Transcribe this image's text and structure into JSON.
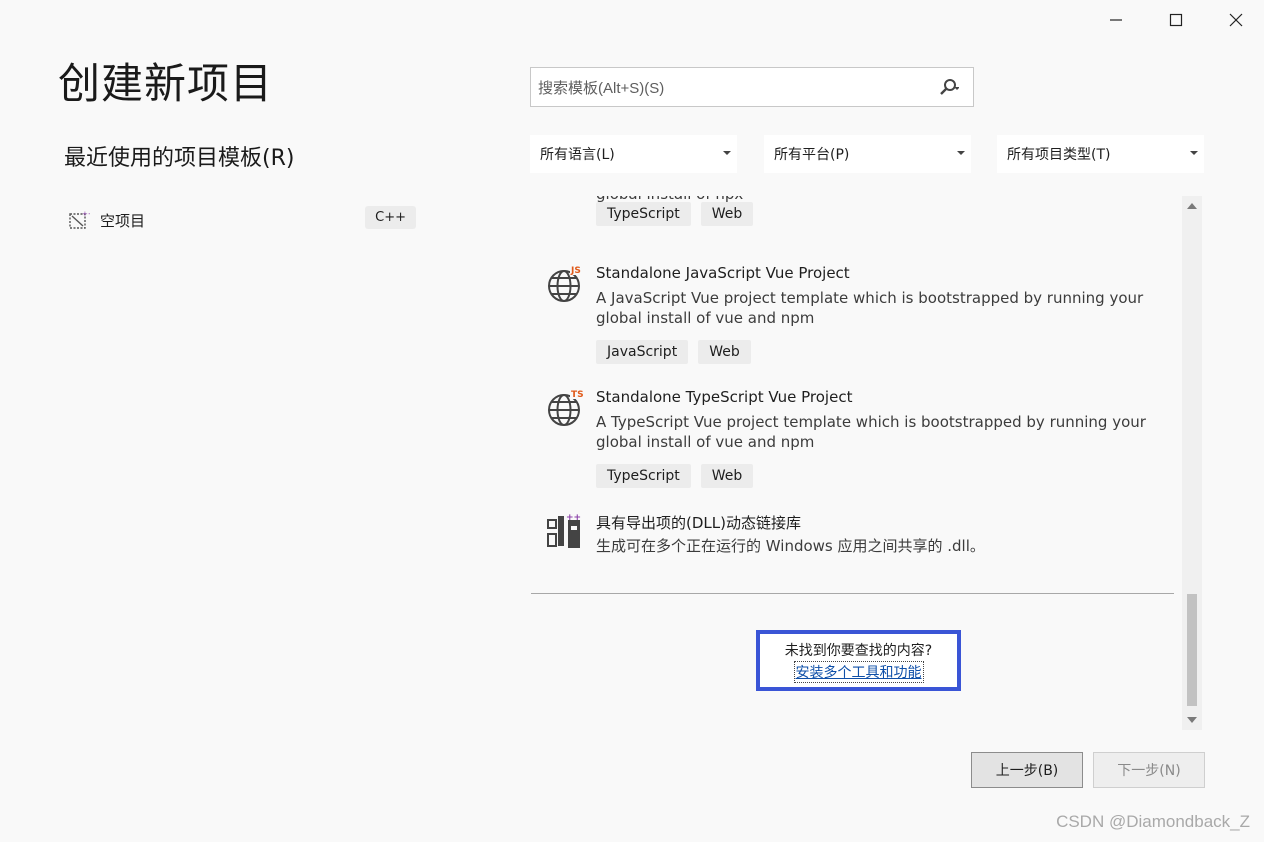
{
  "window": {
    "minimize_icon": "minimize-icon",
    "maximize_icon": "maximize-icon",
    "close_icon": "close-icon"
  },
  "page_title": "创建新项目",
  "recent": {
    "title": "最近使用的项目模板(R)",
    "items": [
      {
        "icon": "empty-project-icon",
        "label": "空项目",
        "language": "C++"
      }
    ]
  },
  "search": {
    "placeholder": "搜索模板(Alt+S)(S)",
    "value": ""
  },
  "filters": {
    "language": "所有语言(L)",
    "platform": "所有平台(P)",
    "project_type": "所有项目类型(T)"
  },
  "templates": [
    {
      "name": "",
      "description": "global install of npx",
      "tags": [
        "TypeScript",
        "Web"
      ],
      "icon": "partial"
    },
    {
      "name": "Standalone JavaScript Vue Project",
      "description": "A JavaScript Vue project template which is bootstrapped by running your global install of vue and npm",
      "tags": [
        "JavaScript",
        "Web"
      ],
      "icon": "globe-js-icon",
      "badge": "JS"
    },
    {
      "name": "Standalone TypeScript Vue Project",
      "description": "A TypeScript Vue project template which is bootstrapped by running your global install of vue and npm",
      "tags": [
        "TypeScript",
        "Web"
      ],
      "icon": "globe-ts-icon",
      "badge": "TS"
    },
    {
      "name": "具有导出项的(DLL)动态链接库",
      "description": "生成可在多个正在运行的 Windows 应用之间共享的 .dll。",
      "tags": [],
      "icon": "dll-icon"
    }
  ],
  "not_found": {
    "question": "未找到你要查找的内容?",
    "link": "安装多个工具和功能"
  },
  "buttons": {
    "back": "上一步(B)",
    "next": "下一步(N)"
  },
  "watermark": "CSDN @Diamondback_Z",
  "colors": {
    "accent_box": "#3a55d6",
    "link": "#0e4fa8",
    "js_badge": "#e05a1a",
    "ts_badge": "#e05a1a",
    "dll_plus": "#8a3fa8"
  }
}
